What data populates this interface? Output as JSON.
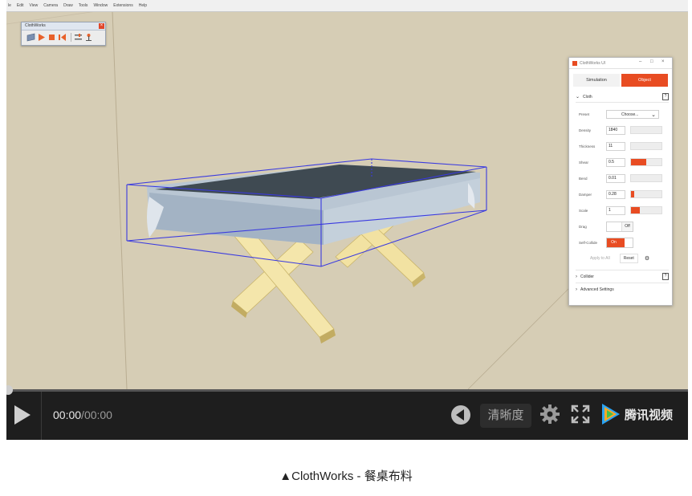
{
  "menubar": {
    "items": [
      "le",
      "Edit",
      "View",
      "Camera",
      "Draw",
      "Tools",
      "Window",
      "Extensions",
      "Help"
    ]
  },
  "toolbar": {
    "title": "ClothWorks",
    "close": "×"
  },
  "dialog": {
    "title": "ClothWorks UI",
    "tabs": [
      "Simulation",
      "Object"
    ],
    "active_tab": "Object",
    "cloth_section": "Cloth",
    "help": "?",
    "preset": {
      "label": "Preset",
      "value": "Choose..."
    },
    "properties": [
      {
        "label": "Density",
        "value": "1840",
        "fill": 0.0
      },
      {
        "label": "Thickness",
        "value": "11",
        "fill": 0.0
      },
      {
        "label": "Shear",
        "value": "0.5",
        "fill": 0.5
      },
      {
        "label": "Bend",
        "value": "0.01",
        "fill": 0.0
      },
      {
        "label": "Damper",
        "value": "0.28",
        "fill": 0.1
      },
      {
        "label": "Scale",
        "value": "1",
        "fill": 0.3
      }
    ],
    "drag": {
      "label": "Drag",
      "value": "Off"
    },
    "self_collide": {
      "label": "Self-Collide",
      "value": "On"
    },
    "apply_all": "Apply to All",
    "reset": "Reset",
    "collider_section": "Collider",
    "advanced_section": "Advanced Settings"
  },
  "player": {
    "current_time": "00:00",
    "separator": "/",
    "duration": "00:00",
    "quality": "清晰度",
    "brand": "腾讯视频",
    "progress": 0.0
  },
  "caption": "▲ClothWorks - 餐桌布料",
  "colors": {
    "accent": "#e84c22",
    "viewport_bg": "#d6cdb5",
    "player_bg": "#1e1e1e",
    "wood": "#f2e2a2",
    "cloth": "#a9b8c8",
    "bounding_box": "#3a3ae0"
  }
}
